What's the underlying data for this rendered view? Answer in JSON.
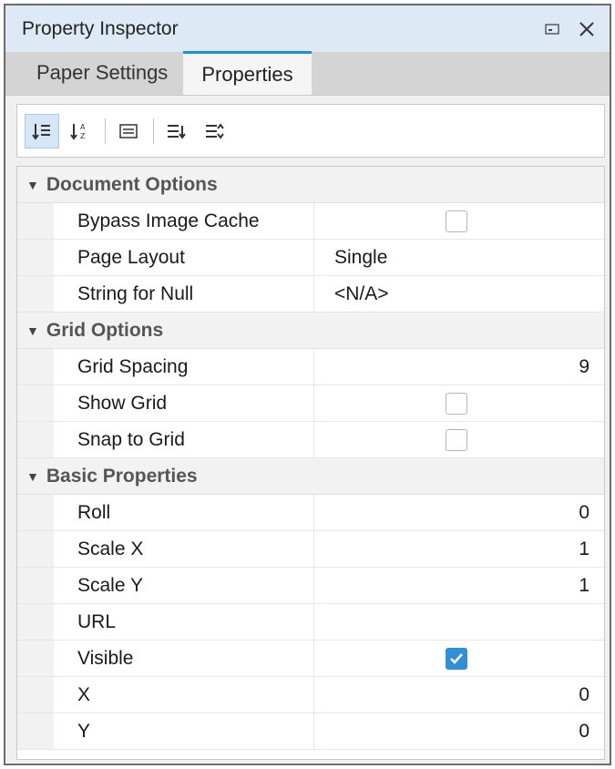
{
  "window": {
    "title": "Property Inspector",
    "restore_icon": "restore-icon",
    "close_icon": "close-icon"
  },
  "tabs": [
    {
      "label": "Paper Settings",
      "active": false
    },
    {
      "label": "Properties",
      "active": true
    }
  ],
  "toolbar": [
    {
      "icon": "sort-categorized-icon",
      "selected": true
    },
    {
      "icon": "sort-alphabetical-icon",
      "selected": false
    },
    {
      "icon": "property-pages-icon",
      "selected": false
    },
    {
      "icon": "expand-all-icon",
      "selected": false
    },
    {
      "icon": "collapse-all-icon",
      "selected": false
    }
  ],
  "sections": [
    {
      "title": "Document Options",
      "rows": [
        {
          "name": "Bypass Image Cache",
          "type": "checkbox",
          "checked": false
        },
        {
          "name": "Page Layout",
          "type": "text",
          "value": "Single"
        },
        {
          "name": "String for Null",
          "type": "text",
          "value": "<N/A>"
        }
      ]
    },
    {
      "title": "Grid Options",
      "rows": [
        {
          "name": "Grid Spacing",
          "type": "number",
          "value": "9"
        },
        {
          "name": "Show Grid",
          "type": "checkbox",
          "checked": false
        },
        {
          "name": "Snap to Grid",
          "type": "checkbox",
          "checked": false
        }
      ]
    },
    {
      "title": "Basic Properties",
      "rows": [
        {
          "name": "Roll",
          "type": "number",
          "value": "0"
        },
        {
          "name": "Scale X",
          "type": "number",
          "value": "1"
        },
        {
          "name": "Scale Y",
          "type": "number",
          "value": "1"
        },
        {
          "name": "URL",
          "type": "text",
          "value": ""
        },
        {
          "name": "Visible",
          "type": "checkbox",
          "checked": true
        },
        {
          "name": "X",
          "type": "number",
          "value": "0"
        },
        {
          "name": "Y",
          "type": "number",
          "value": "0"
        }
      ]
    }
  ],
  "colors": {
    "accent": "#1e8fd5",
    "checkbox_on": "#2f8fd8",
    "titlebar": "#ddeaf6"
  }
}
